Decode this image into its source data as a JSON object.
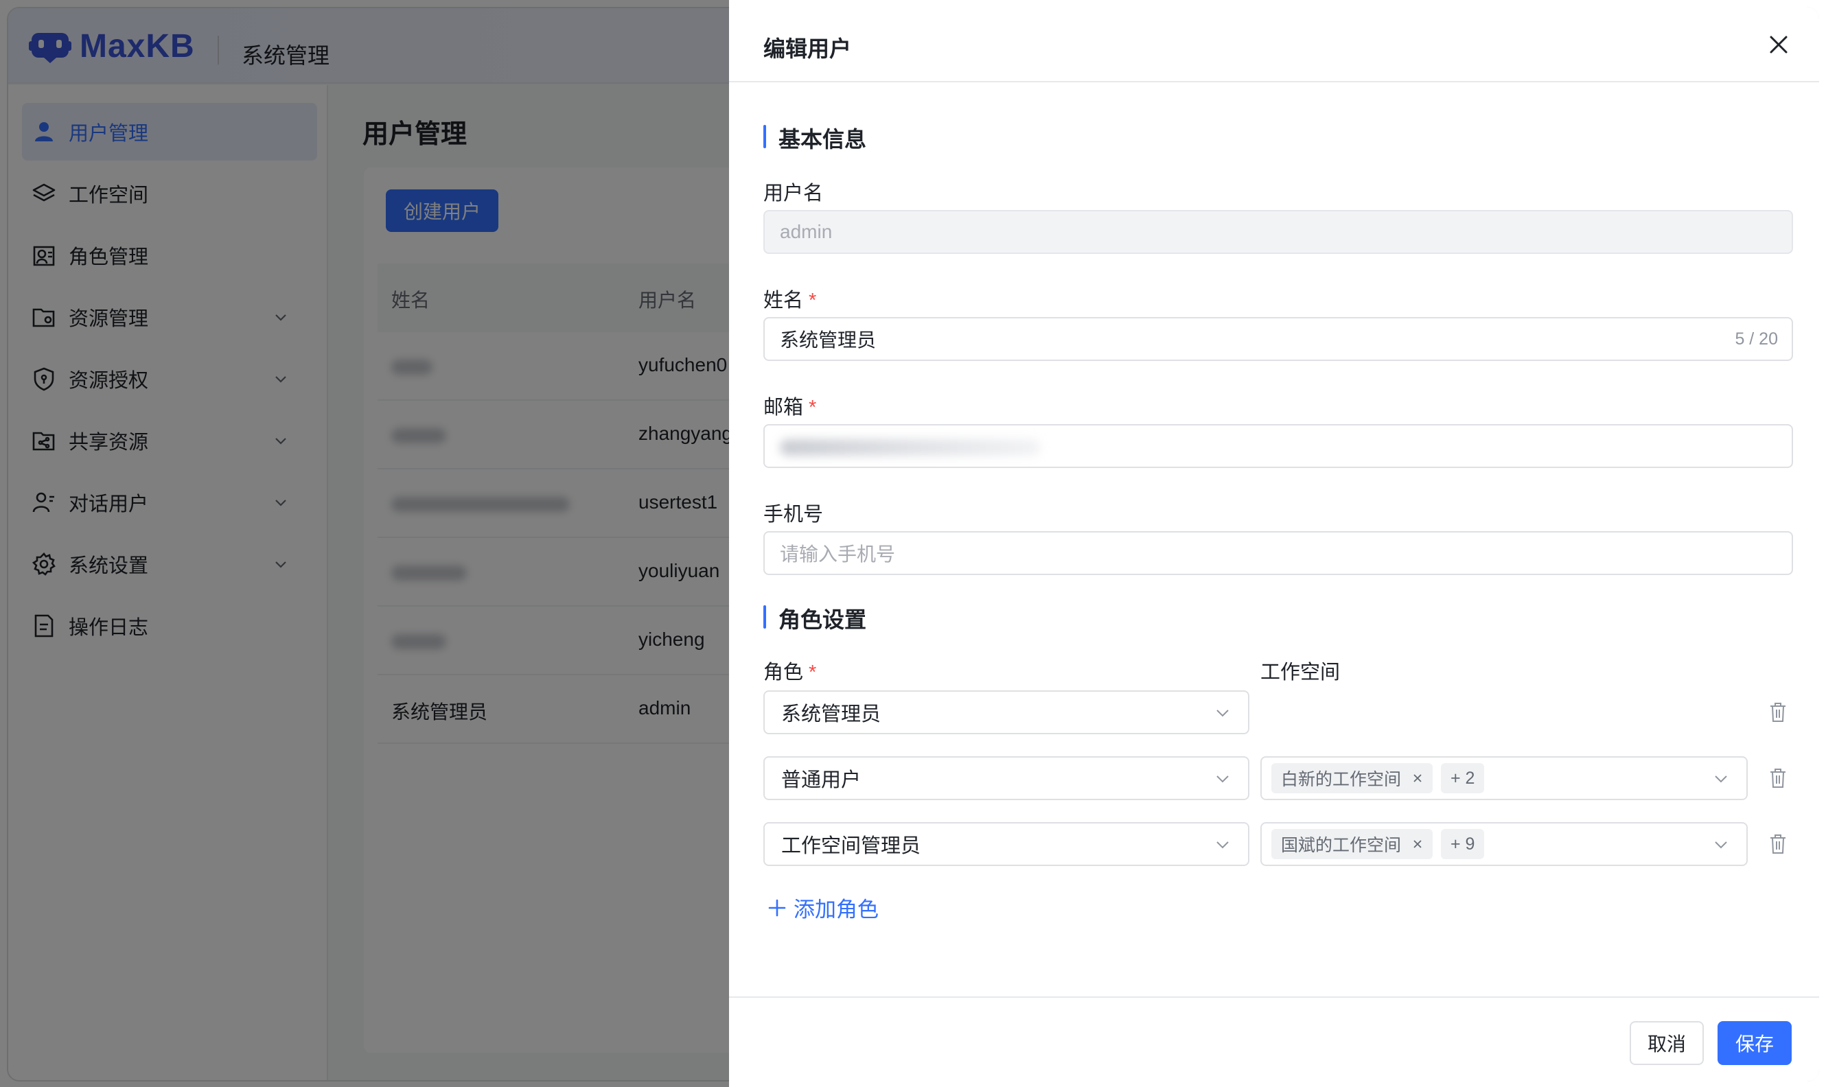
{
  "app": {
    "logo_text": "MaxKB",
    "header_title": "系统管理"
  },
  "sidebar": {
    "items": [
      {
        "label": "用户管理",
        "icon": "user-icon",
        "active": true
      },
      {
        "label": "工作空间",
        "icon": "layers-icon"
      },
      {
        "label": "角色管理",
        "icon": "role-icon"
      },
      {
        "label": "资源管理",
        "icon": "folder-settings-icon",
        "expandable": true
      },
      {
        "label": "资源授权",
        "icon": "shield-icon",
        "expandable": true
      },
      {
        "label": "共享资源",
        "icon": "share-folder-icon",
        "expandable": true
      },
      {
        "label": "对话用户",
        "icon": "chat-user-icon",
        "expandable": true
      },
      {
        "label": "系统设置",
        "icon": "gear-icon",
        "expandable": true
      },
      {
        "label": "操作日志",
        "icon": "log-icon"
      }
    ]
  },
  "main": {
    "title": "用户管理",
    "create_button": "创建用户",
    "table": {
      "columns": [
        "姓名",
        "用户名"
      ],
      "rows": [
        {
          "name": "",
          "username": "yufuchen0"
        },
        {
          "name": "",
          "username": "zhangyang"
        },
        {
          "name": "",
          "username": "usertest1"
        },
        {
          "name": "",
          "username": "youliyuan"
        },
        {
          "name": "",
          "username": "yicheng"
        },
        {
          "name": "系统管理员",
          "username": "admin"
        }
      ]
    }
  },
  "drawer": {
    "title": "编辑用户",
    "basic_section": "基本信息",
    "username_label": "用户名",
    "username_value": "admin",
    "name_label": "姓名",
    "name_value": "系统管理员",
    "name_counter": "5 / 20",
    "email_label": "邮箱",
    "phone_label": "手机号",
    "phone_placeholder": "请输入手机号",
    "role_section": "角色设置",
    "role_label": "角色",
    "workspace_label": "工作空间",
    "roles": [
      {
        "role": "系统管理员",
        "workspace_tag": "",
        "more": ""
      },
      {
        "role": "普通用户",
        "workspace_tag": "白新的工作空间",
        "more": "+ 2"
      },
      {
        "role": "工作空间管理员",
        "workspace_tag": "国斌的工作空间",
        "more": "+ 9"
      }
    ],
    "add_role": "添加角色",
    "cancel": "取消",
    "save": "保存"
  },
  "colors": {
    "primary": "#3370ff",
    "required": "#f54a45",
    "overlay": "rgba(0,0,0,0.5)"
  }
}
